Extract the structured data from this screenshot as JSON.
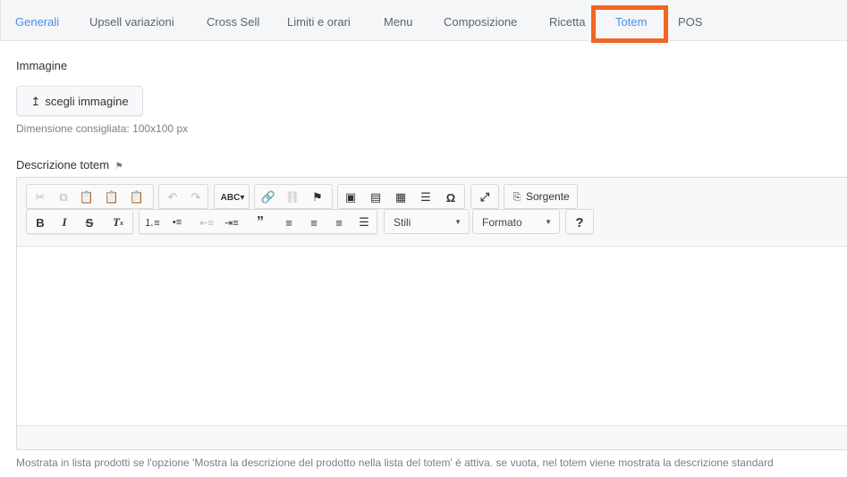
{
  "tabs": [
    {
      "label": "Generali",
      "active": true
    },
    {
      "label": "Upsell variazioni",
      "active": false
    },
    {
      "label": "Cross Sell",
      "active": false
    },
    {
      "label": "Limiti e orari",
      "active": false
    },
    {
      "label": "Menu",
      "active": false
    },
    {
      "label": "Composizione",
      "active": false
    },
    {
      "label": "Ricetta",
      "active": false
    },
    {
      "label": "Totem",
      "active": true
    },
    {
      "label": "POS",
      "active": false
    }
  ],
  "image": {
    "label": "Immagine",
    "upload_button": "scegli immagine",
    "hint": "Dimensione consigliata: 100x100 px"
  },
  "description": {
    "label": "Descrizione totem",
    "flag_icon": "flag-icon",
    "source_button": "Sorgente",
    "styles_select": "Stili",
    "format_select": "Formato",
    "help_button": "?",
    "footer_hint": "Mostrata in lista prodotti se l'opzione 'Mostra la descrizione del prodotto nella lista del totem' è attiva. se vuota, nel totem viene mostrata la descrizione standard"
  },
  "colors": {
    "active_tab": "#4a8fe0",
    "highlight": "#f26522"
  }
}
